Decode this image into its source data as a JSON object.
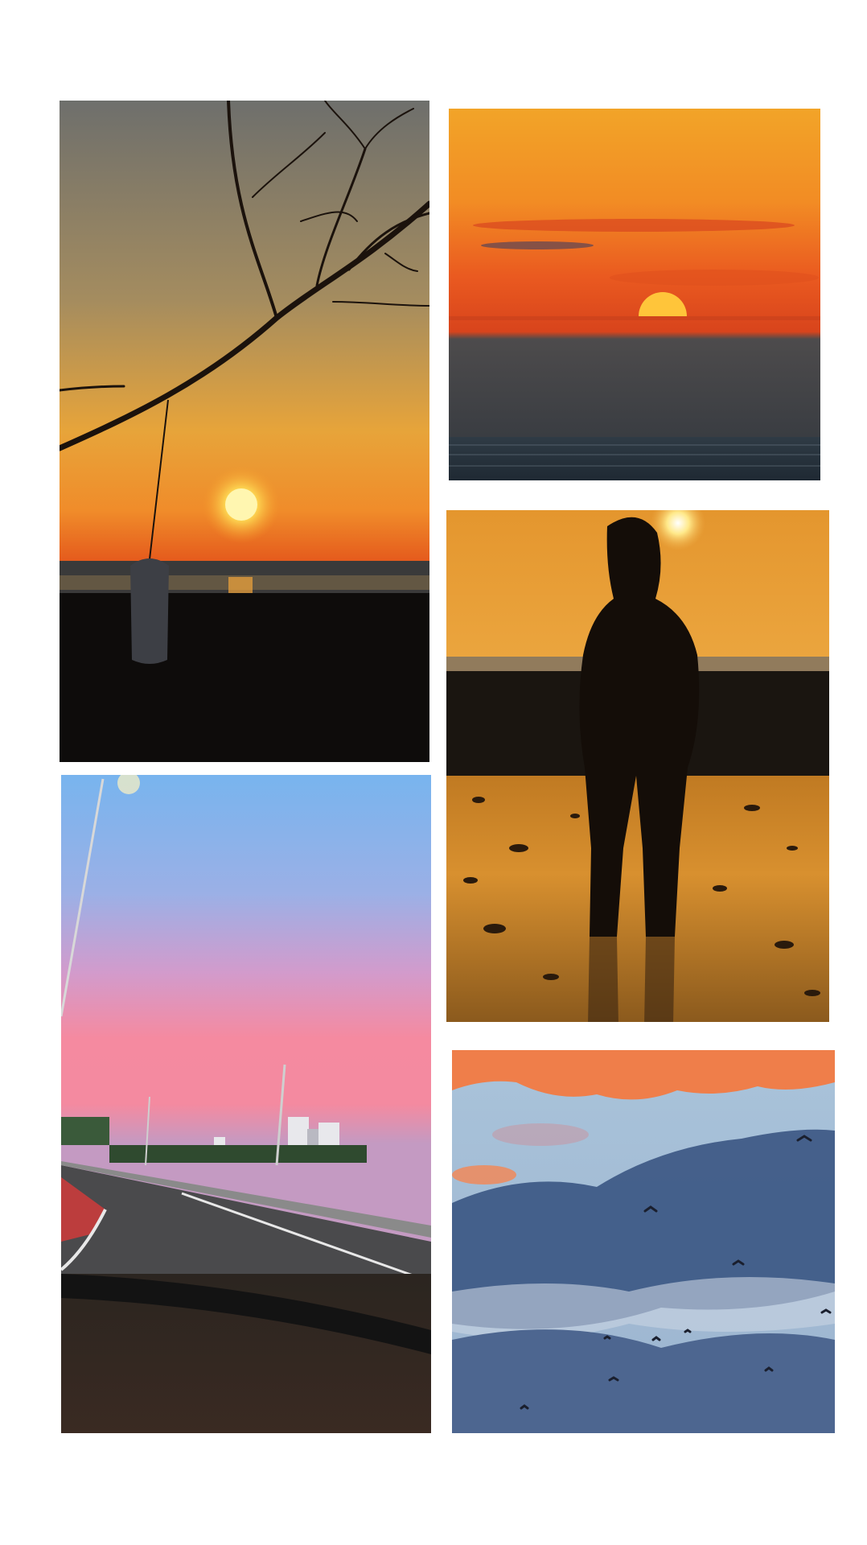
{
  "collage": {
    "background": "#ffffff",
    "photos": [
      {
        "name": "photo-branch-sunset",
        "palette": [
          "#6e6f6c",
          "#f59a2a",
          "#e8581a",
          "#0d0b0a"
        ]
      },
      {
        "name": "photo-ocean-sunset",
        "palette": [
          "#f0a020",
          "#e8421c",
          "#4b4c4d",
          "#2e3a44"
        ]
      },
      {
        "name": "photo-silhouette-tideflats",
        "palette": [
          "#f2b047",
          "#e6932c",
          "#1a1510",
          "#d8902f"
        ]
      },
      {
        "name": "photo-highway-pink-sky",
        "palette": [
          "#7bb6ee",
          "#f58aa0",
          "#3a3a3d",
          "#2b2520"
        ]
      },
      {
        "name": "photo-birds-clouds",
        "palette": [
          "#a9c3da",
          "#3f5b87",
          "#ef7e4a",
          "#2a3450"
        ]
      }
    ]
  }
}
